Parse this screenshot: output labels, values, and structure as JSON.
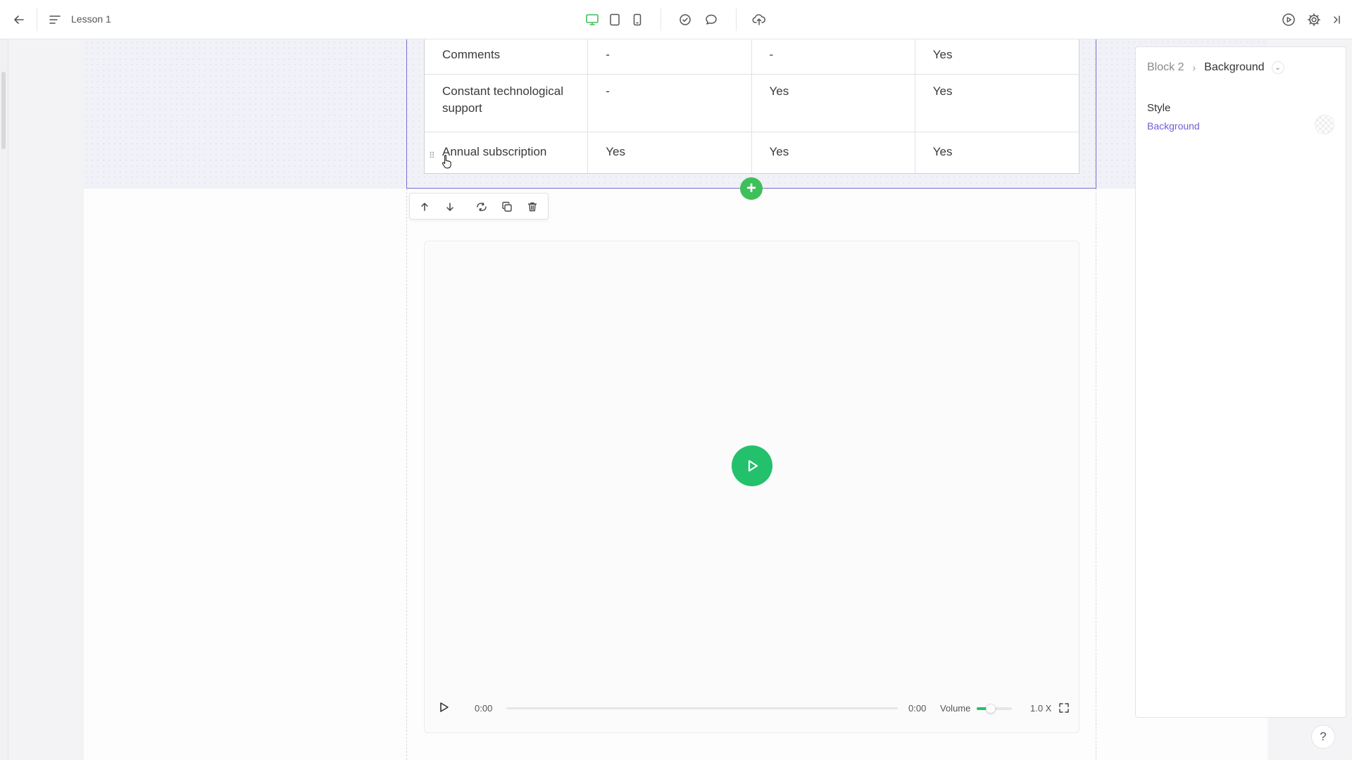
{
  "header": {
    "lesson_title": "Lesson 1",
    "icons": [
      "back-arrow-icon",
      "outline-menu-icon",
      "desktop-icon",
      "tablet-icon",
      "mobile-icon",
      "check-circle-icon",
      "comment-icon",
      "publish-cloud-icon",
      "preview-play-icon",
      "settings-gear-icon",
      "collapse-panel-icon"
    ],
    "active_device": "desktop",
    "accent_color": "#3fbf5a"
  },
  "table": {
    "rows": [
      {
        "feature": "Comments",
        "col1": "-",
        "col2": "-",
        "col3": "Yes"
      },
      {
        "feature": "Constant technological support",
        "col1": "-",
        "col2": "Yes",
        "col3": "Yes"
      },
      {
        "feature": "Annual subscription",
        "col1": "Yes",
        "col2": "Yes",
        "col3": "Yes"
      }
    ]
  },
  "block_toolbar": {
    "icons": [
      "move-up-icon",
      "move-down-icon",
      "replace-icon",
      "duplicate-icon",
      "delete-icon"
    ]
  },
  "video_player": {
    "current_time": "0:00",
    "duration": "0:00",
    "progress": 0,
    "volume_label": "Volume",
    "volume_level": 0.4,
    "speed": "1.0 X",
    "play_color": "#23c16b"
  },
  "right_panel": {
    "breadcrumb_block": "Block 2",
    "breadcrumb_current": "Background",
    "style_label": "Style",
    "background_link": "Background",
    "link_color": "#6d5fd6"
  },
  "help": {
    "label": "?"
  }
}
